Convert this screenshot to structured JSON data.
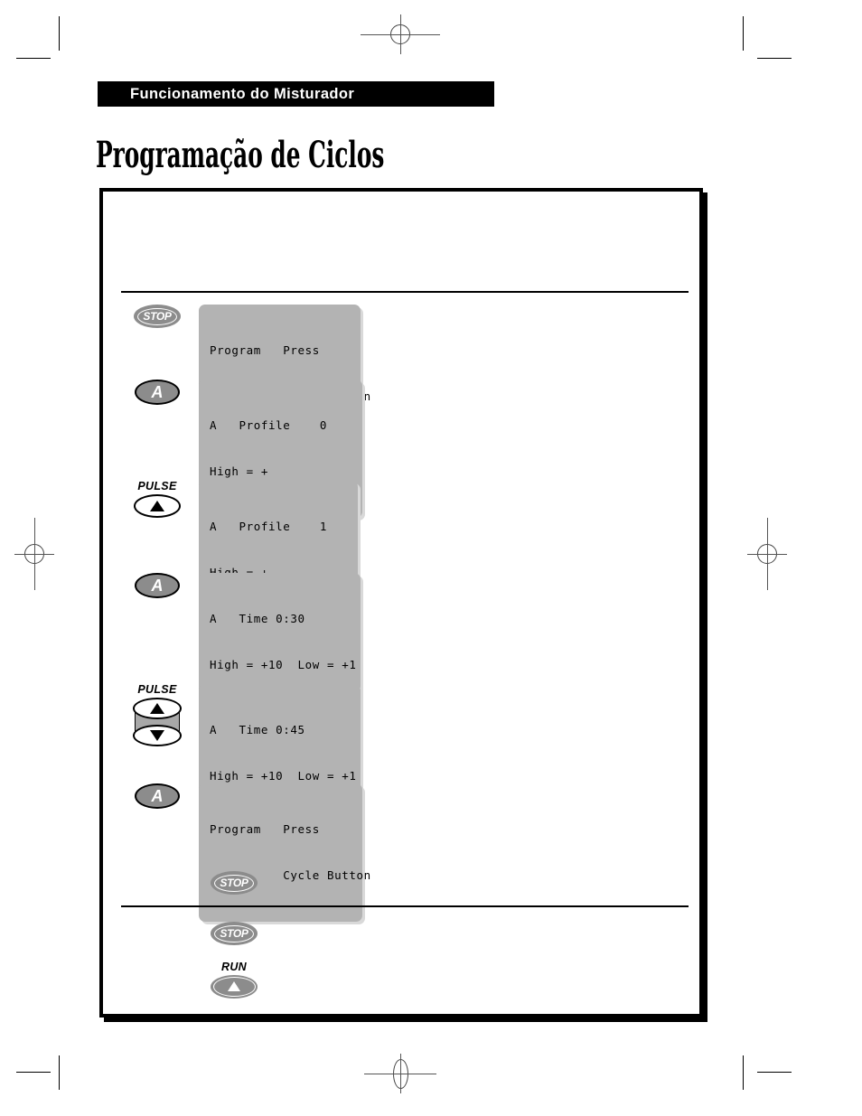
{
  "page": {
    "section_header": "Funcionamento do Misturador",
    "title": "Programação de Ciclos"
  },
  "steps": [
    {
      "id": "step-stop-program",
      "control": {
        "type": "stop-button",
        "label": "STOP",
        "caption": ""
      },
      "lcd": {
        "line1": "Program   Press",
        "line2": "          Cycle Button"
      }
    },
    {
      "id": "step-a-profile-0",
      "control": {
        "type": "a-button",
        "label": "A",
        "caption": ""
      },
      "lcd": {
        "line1": "A   Profile    0",
        "line2": "High = +"
      }
    },
    {
      "id": "step-pulse-profile-1",
      "control": {
        "type": "pulse-up-button",
        "label": "",
        "caption": "PULSE"
      },
      "lcd": {
        "line1": "A   Profile    1",
        "line2": "High = +"
      }
    },
    {
      "id": "step-a-time-030",
      "control": {
        "type": "a-button",
        "label": "A",
        "caption": ""
      },
      "lcd": {
        "line1": "A   Time 0:30",
        "line2": "High = +10  Low = +1"
      }
    },
    {
      "id": "step-pulse-time-045",
      "control": {
        "type": "pulse-rocker-button",
        "label": "",
        "caption": "PULSE"
      },
      "lcd": {
        "line1": "A   Time 0:45",
        "line2": "High = +10  Low = +1"
      }
    },
    {
      "id": "step-a-program",
      "control": {
        "type": "a-button",
        "label": "A",
        "caption": ""
      },
      "lcd": {
        "line1": "Program   Press",
        "line2": "          Cycle Button"
      }
    },
    {
      "id": "step-stop-exit",
      "control": {
        "type": "stop-button",
        "label": "STOP",
        "caption": ""
      },
      "lcd": null
    }
  ],
  "footer_steps": [
    {
      "id": "footer-stop",
      "control": {
        "type": "stop-button",
        "label": "STOP",
        "caption": ""
      }
    },
    {
      "id": "footer-run",
      "control": {
        "type": "run-button",
        "label": "",
        "caption": "RUN"
      }
    }
  ],
  "colors": {
    "band_background": "#000000",
    "band_text": "#ffffff",
    "lcd_background": "#b3b3b3",
    "lcd_shadow": "#d9d9d9",
    "button_gray": "#8c8c8c",
    "rocker_gray": "#a8a8a8",
    "box_border": "#000000"
  }
}
